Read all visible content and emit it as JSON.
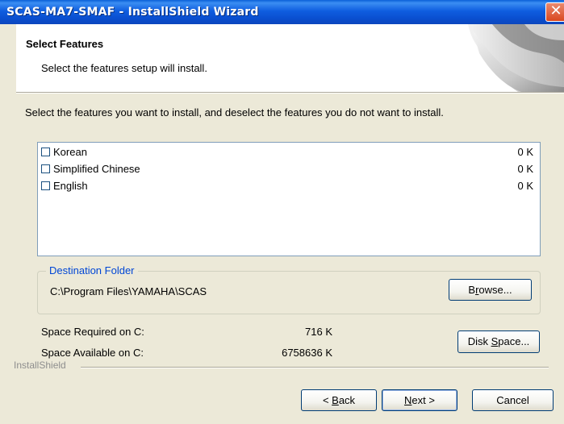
{
  "window": {
    "title": "SCAS-MA7-SMAF - InstallShield Wizard",
    "close_glyph": "✕"
  },
  "header": {
    "title": "Select Features",
    "subtitle": "Select the features setup will install."
  },
  "instruction": "Select the features you want to install, and deselect the features you do not want to install.",
  "features": [
    {
      "name": "Korean",
      "size": "0 K",
      "checked": false
    },
    {
      "name": "Simplified Chinese",
      "size": "0 K",
      "checked": false
    },
    {
      "name": "English",
      "size": "0 K",
      "checked": false
    }
  ],
  "destination": {
    "legend": "Destination Folder",
    "path": "C:\\Program Files\\YAMAHA\\SCAS",
    "browse_pre": "B",
    "browse_mn": "r",
    "browse_post": "owse..."
  },
  "space": {
    "required_label": "Space Required on  C:",
    "required_value": "716 K",
    "available_label": "Space Available on  C:",
    "available_value": "6758636 K",
    "disk_pre": "Disk ",
    "disk_mn": "S",
    "disk_post": "pace..."
  },
  "brand": "InstallShield",
  "buttons": {
    "back_pre": "< ",
    "back_mn": "B",
    "back_post": "ack",
    "next_mn": "N",
    "next_post": "ext >",
    "cancel": "Cancel"
  },
  "colors": {
    "titlebar": "#0a5fd8",
    "legend": "#0046d5",
    "dialog_bg": "#ece9d8"
  }
}
